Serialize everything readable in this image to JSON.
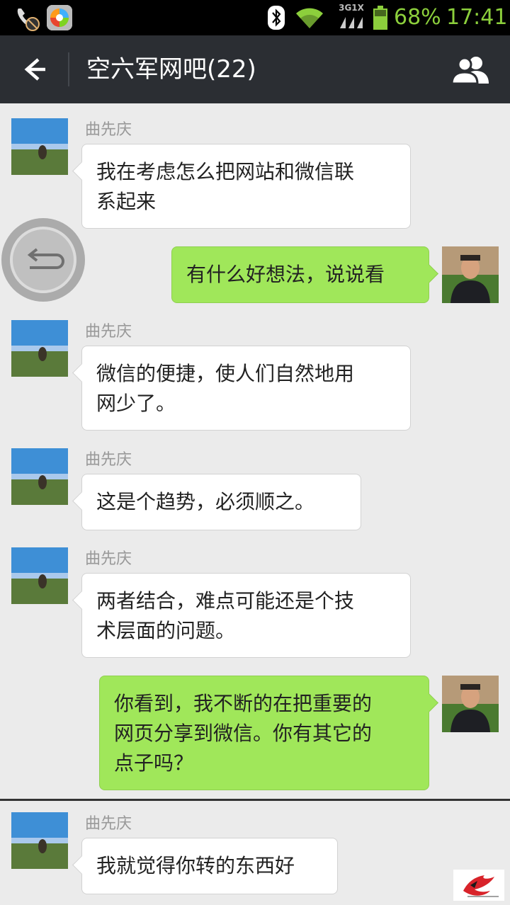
{
  "status_bar": {
    "network_label": "3G1X",
    "battery_percent": "68%",
    "time": "17:41",
    "icons": [
      "missed-call-icon",
      "app-store-icon",
      "bluetooth-icon",
      "wifi-icon",
      "network-icon",
      "battery-icon"
    ],
    "accent_color": "#8ccf3c"
  },
  "header": {
    "title": "空六军网吧(22)",
    "back_icon": "arrow-left-icon",
    "members_icon": "group-members-icon",
    "background": "#2b2e33"
  },
  "messages": [
    {
      "side": "left",
      "sender": "曲先庆",
      "lines": [
        "我在考虑怎么把网站和微信联",
        "系起来"
      ]
    },
    {
      "side": "right",
      "lines": [
        "有什么好想法，说说看"
      ]
    },
    {
      "side": "left",
      "sender": "曲先庆",
      "lines": [
        "微信的便捷，使人们自然地用",
        "网少了。"
      ]
    },
    {
      "side": "left",
      "sender": "曲先庆",
      "lines": [
        "这是个趋势，必须顺之。"
      ]
    },
    {
      "side": "left",
      "sender": "曲先庆",
      "lines": [
        "两者结合，难点可能还是个技",
        "术层面的问题。"
      ]
    },
    {
      "side": "right",
      "lines": [
        "你看到，我不断的在把重要的",
        "网页分享到微信。你有其它的",
        "点子吗？"
      ]
    },
    {
      "side": "left",
      "sender": "曲先庆",
      "lines": [
        "我就觉得你转的东西好"
      ]
    }
  ],
  "colors": {
    "chat_background": "#ebebeb",
    "self_bubble": "#a0e75a",
    "other_bubble": "#ffffff"
  }
}
